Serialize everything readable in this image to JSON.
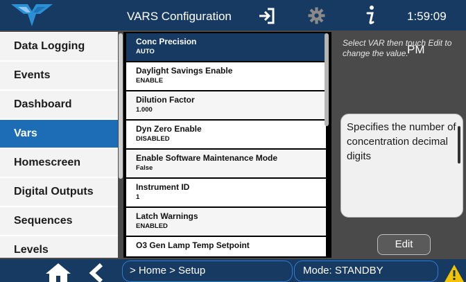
{
  "header": {
    "title": "VARS Configuration",
    "clock": "1:59:09 PM"
  },
  "icons": {
    "logo": "teledyne-logo",
    "exit": "exit-icon",
    "settings": "gear-icon",
    "info": "info-icon",
    "home": "home-icon",
    "back": "back-icon",
    "warning": "warning-icon"
  },
  "sidebar": {
    "items": [
      {
        "label": "Data Logging",
        "active": false
      },
      {
        "label": "Events",
        "active": false
      },
      {
        "label": "Dashboard",
        "active": false
      },
      {
        "label": "Vars",
        "active": true
      },
      {
        "label": "Homescreen",
        "active": false
      },
      {
        "label": "Digital Outputs",
        "active": false
      },
      {
        "label": "Sequences",
        "active": false
      },
      {
        "label": "Levels",
        "active": false
      }
    ]
  },
  "vars": {
    "items": [
      {
        "name": "Conc Precision",
        "value": "AUTO",
        "selected": true
      },
      {
        "name": "Daylight Savings Enable",
        "value": "ENABLE"
      },
      {
        "name": "Dilution Factor",
        "value": "1.000"
      },
      {
        "name": "Dyn Zero Enable",
        "value": "DISABLED"
      },
      {
        "name": "Enable Software Maintenance Mode",
        "value": "False"
      },
      {
        "name": "Instrument ID",
        "value": "1"
      },
      {
        "name": "Latch Warnings",
        "value": "ENABLED"
      },
      {
        "name": "O3 Gen Lamp Temp Setpoint",
        "value": ""
      }
    ]
  },
  "panel": {
    "hint": "Select VAR then touch Edit to change the value.",
    "description": "Specifies the number of concentration decimal digits",
    "edit_label": "Edit"
  },
  "footer": {
    "breadcrumb": "> Home > Setup",
    "mode": "Mode: STANDBY"
  },
  "colors": {
    "header_bg": "#173a63",
    "accent": "#1c6db5",
    "warning": "#f5c400"
  }
}
